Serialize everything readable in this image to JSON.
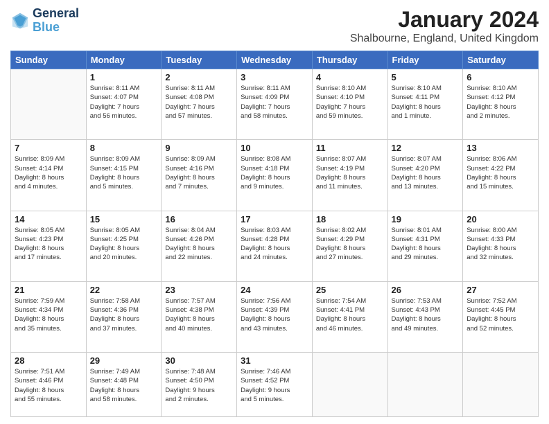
{
  "header": {
    "logo_line1": "General",
    "logo_line2": "Blue",
    "month": "January 2024",
    "location": "Shalbourne, England, United Kingdom"
  },
  "weekdays": [
    "Sunday",
    "Monday",
    "Tuesday",
    "Wednesday",
    "Thursday",
    "Friday",
    "Saturday"
  ],
  "weeks": [
    [
      {
        "day": "",
        "info": ""
      },
      {
        "day": "1",
        "info": "Sunrise: 8:11 AM\nSunset: 4:07 PM\nDaylight: 7 hours\nand 56 minutes."
      },
      {
        "day": "2",
        "info": "Sunrise: 8:11 AM\nSunset: 4:08 PM\nDaylight: 7 hours\nand 57 minutes."
      },
      {
        "day": "3",
        "info": "Sunrise: 8:11 AM\nSunset: 4:09 PM\nDaylight: 7 hours\nand 58 minutes."
      },
      {
        "day": "4",
        "info": "Sunrise: 8:10 AM\nSunset: 4:10 PM\nDaylight: 7 hours\nand 59 minutes."
      },
      {
        "day": "5",
        "info": "Sunrise: 8:10 AM\nSunset: 4:11 PM\nDaylight: 8 hours\nand 1 minute."
      },
      {
        "day": "6",
        "info": "Sunrise: 8:10 AM\nSunset: 4:12 PM\nDaylight: 8 hours\nand 2 minutes."
      }
    ],
    [
      {
        "day": "7",
        "info": "Sunrise: 8:09 AM\nSunset: 4:14 PM\nDaylight: 8 hours\nand 4 minutes."
      },
      {
        "day": "8",
        "info": "Sunrise: 8:09 AM\nSunset: 4:15 PM\nDaylight: 8 hours\nand 5 minutes."
      },
      {
        "day": "9",
        "info": "Sunrise: 8:09 AM\nSunset: 4:16 PM\nDaylight: 8 hours\nand 7 minutes."
      },
      {
        "day": "10",
        "info": "Sunrise: 8:08 AM\nSunset: 4:18 PM\nDaylight: 8 hours\nand 9 minutes."
      },
      {
        "day": "11",
        "info": "Sunrise: 8:07 AM\nSunset: 4:19 PM\nDaylight: 8 hours\nand 11 minutes."
      },
      {
        "day": "12",
        "info": "Sunrise: 8:07 AM\nSunset: 4:20 PM\nDaylight: 8 hours\nand 13 minutes."
      },
      {
        "day": "13",
        "info": "Sunrise: 8:06 AM\nSunset: 4:22 PM\nDaylight: 8 hours\nand 15 minutes."
      }
    ],
    [
      {
        "day": "14",
        "info": "Sunrise: 8:05 AM\nSunset: 4:23 PM\nDaylight: 8 hours\nand 17 minutes."
      },
      {
        "day": "15",
        "info": "Sunrise: 8:05 AM\nSunset: 4:25 PM\nDaylight: 8 hours\nand 20 minutes."
      },
      {
        "day": "16",
        "info": "Sunrise: 8:04 AM\nSunset: 4:26 PM\nDaylight: 8 hours\nand 22 minutes."
      },
      {
        "day": "17",
        "info": "Sunrise: 8:03 AM\nSunset: 4:28 PM\nDaylight: 8 hours\nand 24 minutes."
      },
      {
        "day": "18",
        "info": "Sunrise: 8:02 AM\nSunset: 4:29 PM\nDaylight: 8 hours\nand 27 minutes."
      },
      {
        "day": "19",
        "info": "Sunrise: 8:01 AM\nSunset: 4:31 PM\nDaylight: 8 hours\nand 29 minutes."
      },
      {
        "day": "20",
        "info": "Sunrise: 8:00 AM\nSunset: 4:33 PM\nDaylight: 8 hours\nand 32 minutes."
      }
    ],
    [
      {
        "day": "21",
        "info": "Sunrise: 7:59 AM\nSunset: 4:34 PM\nDaylight: 8 hours\nand 35 minutes."
      },
      {
        "day": "22",
        "info": "Sunrise: 7:58 AM\nSunset: 4:36 PM\nDaylight: 8 hours\nand 37 minutes."
      },
      {
        "day": "23",
        "info": "Sunrise: 7:57 AM\nSunset: 4:38 PM\nDaylight: 8 hours\nand 40 minutes."
      },
      {
        "day": "24",
        "info": "Sunrise: 7:56 AM\nSunset: 4:39 PM\nDaylight: 8 hours\nand 43 minutes."
      },
      {
        "day": "25",
        "info": "Sunrise: 7:54 AM\nSunset: 4:41 PM\nDaylight: 8 hours\nand 46 minutes."
      },
      {
        "day": "26",
        "info": "Sunrise: 7:53 AM\nSunset: 4:43 PM\nDaylight: 8 hours\nand 49 minutes."
      },
      {
        "day": "27",
        "info": "Sunrise: 7:52 AM\nSunset: 4:45 PM\nDaylight: 8 hours\nand 52 minutes."
      }
    ],
    [
      {
        "day": "28",
        "info": "Sunrise: 7:51 AM\nSunset: 4:46 PM\nDaylight: 8 hours\nand 55 minutes."
      },
      {
        "day": "29",
        "info": "Sunrise: 7:49 AM\nSunset: 4:48 PM\nDaylight: 8 hours\nand 58 minutes."
      },
      {
        "day": "30",
        "info": "Sunrise: 7:48 AM\nSunset: 4:50 PM\nDaylight: 9 hours\nand 2 minutes."
      },
      {
        "day": "31",
        "info": "Sunrise: 7:46 AM\nSunset: 4:52 PM\nDaylight: 9 hours\nand 5 minutes."
      },
      {
        "day": "",
        "info": ""
      },
      {
        "day": "",
        "info": ""
      },
      {
        "day": "",
        "info": ""
      }
    ]
  ]
}
